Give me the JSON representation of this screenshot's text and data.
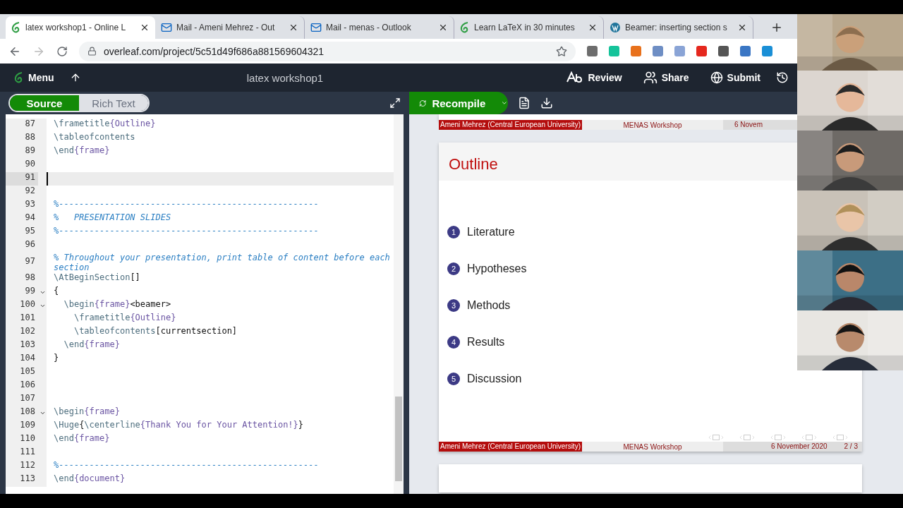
{
  "browser": {
    "tabs": [
      {
        "title": "latex workshop1 - Online L",
        "selected": true
      },
      {
        "title": "Mail - Ameni Mehrez - Out",
        "selected": false
      },
      {
        "title": "Mail - menas - Outlook",
        "selected": false
      },
      {
        "title": "Learn LaTeX in 30 minutes",
        "selected": false
      },
      {
        "title": "Beamer: inserting section s",
        "selected": false
      }
    ],
    "url": "overleaf.com/project/5c51d49f686a881569604321"
  },
  "toolbar": {
    "menu": "Menu",
    "project_title": "latex workshop1",
    "actions": [
      {
        "label": "Review"
      },
      {
        "label": "Share"
      },
      {
        "label": "Submit"
      }
    ]
  },
  "editor": {
    "modes": [
      {
        "label": "Source",
        "selected": true
      },
      {
        "label": "Rich Text",
        "selected": false
      }
    ],
    "lines": [
      {
        "number": "87",
        "text": "\\frametitle{Outline}",
        "kind": "code",
        "fold": false,
        "current": false
      },
      {
        "number": "88",
        "text": "\\tableofcontents",
        "kind": "code",
        "fold": false,
        "current": false
      },
      {
        "number": "89",
        "text": "\\end{frame}",
        "kind": "code",
        "fold": false,
        "current": false
      },
      {
        "number": "90",
        "kind": "code",
        "fold": false,
        "current": false
      },
      {
        "number": "91",
        "kind": "code",
        "fold": false,
        "current": true
      },
      {
        "number": "92",
        "kind": "code",
        "fold": false,
        "current": false
      },
      {
        "number": "93",
        "text": "%---------------------------------------------------",
        "kind": "comment",
        "fold": false,
        "current": false
      },
      {
        "number": "94",
        "text": "%   PRESENTATION SLIDES",
        "kind": "comment",
        "fold": false,
        "current": false
      },
      {
        "number": "95",
        "text": "%---------------------------------------------------",
        "kind": "comment",
        "fold": false,
        "current": false
      },
      {
        "number": "96",
        "kind": "code",
        "fold": false,
        "current": false
      },
      {
        "number": "97",
        "text": "% Throughout your presentation, print table of content before each section",
        "kind": "comment",
        "fold": false,
        "current": false
      },
      {
        "number": "98",
        "text": "\\AtBeginSection[]",
        "kind": "code",
        "fold": false,
        "current": false
      },
      {
        "number": "99",
        "text": "{",
        "kind": "code",
        "fold": true,
        "current": false
      },
      {
        "number": "100",
        "text": "  \\begin{frame}<beamer>",
        "kind": "code",
        "fold": true,
        "current": false
      },
      {
        "number": "101",
        "text": "    \\frametitle{Outline}",
        "kind": "code",
        "fold": false,
        "current": false
      },
      {
        "number": "102",
        "text": "    \\tableofcontents[currentsection]",
        "kind": "code",
        "fold": false,
        "current": false
      },
      {
        "number": "103",
        "text": "  \\end{frame}",
        "kind": "code",
        "fold": false,
        "current": false
      },
      {
        "number": "104",
        "text": "}",
        "kind": "code",
        "fold": false,
        "current": false
      },
      {
        "number": "105",
        "kind": "code",
        "fold": false,
        "current": false
      },
      {
        "number": "106",
        "kind": "code",
        "fold": false,
        "current": false
      },
      {
        "number": "107",
        "kind": "code",
        "fold": false,
        "current": false
      },
      {
        "number": "108",
        "text": "\\begin{frame}",
        "kind": "code",
        "fold": true,
        "current": false
      },
      {
        "number": "109",
        "text": "\\Huge{\\centerline{Thank You for Your Attention!}}",
        "kind": "code",
        "fold": false,
        "current": false
      },
      {
        "number": "110",
        "text": "\\end{frame}",
        "kind": "code",
        "fold": false,
        "current": false
      },
      {
        "number": "111",
        "kind": "code",
        "fold": false,
        "current": false
      },
      {
        "number": "112",
        "text": "%---------------------------------------------------",
        "kind": "comment",
        "fold": false,
        "current": false
      },
      {
        "number": "113",
        "text": "\\end{document}",
        "kind": "code",
        "fold": false,
        "current": false
      }
    ]
  },
  "pdf": {
    "recompile": "Recompile",
    "top_header": {
      "author": "Ameni Mehrez (Central European University)",
      "event": "MENAS Workshop",
      "date": "6 Novem"
    },
    "slide": {
      "title": "Outline",
      "items": [
        {
          "number": "1",
          "label": "Literature"
        },
        {
          "number": "2",
          "label": "Hypotheses"
        },
        {
          "number": "3",
          "label": "Methods"
        },
        {
          "number": "4",
          "label": "Results"
        },
        {
          "number": "5",
          "label": "Discussion"
        }
      ],
      "footer": {
        "author": "Ameni Mehrez (Central European University)",
        "event": "MENAS Workshop",
        "date": "6 November 2020",
        "page": "2 / 3"
      }
    }
  }
}
